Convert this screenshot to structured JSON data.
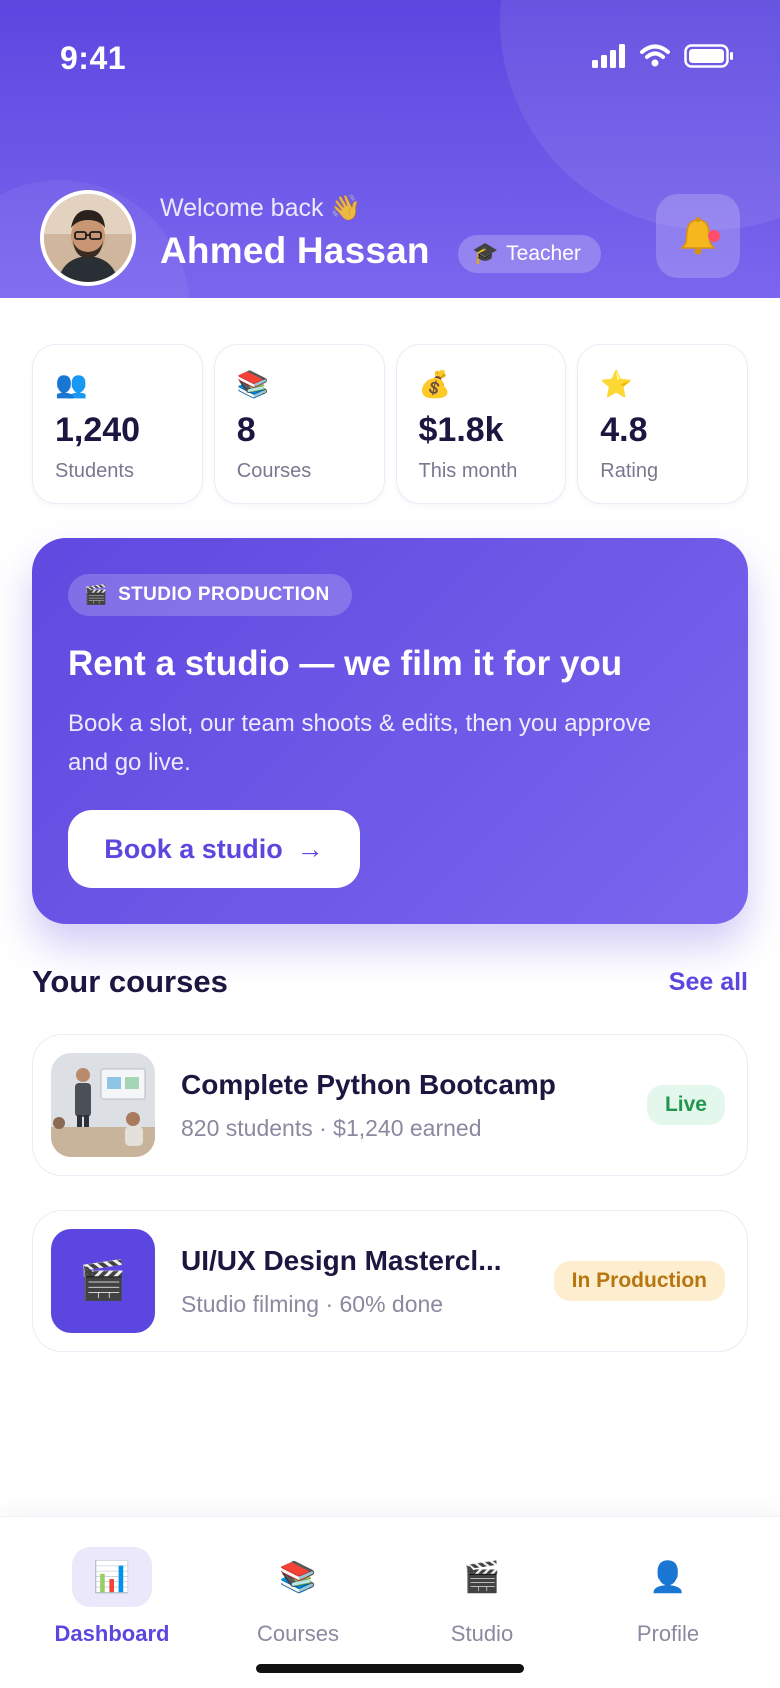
{
  "status_bar": {
    "time": "9:41"
  },
  "header": {
    "welcome": "Welcome back 👋",
    "name": "Ahmed Hassan",
    "role": "Teacher",
    "role_icon": "🎓"
  },
  "stats": [
    {
      "icon": "👥",
      "value": "1,240",
      "label": "Students"
    },
    {
      "icon": "📚",
      "value": "8",
      "label": "Courses"
    },
    {
      "icon": "💰",
      "value": "$1.8k",
      "label": "This month"
    },
    {
      "icon": "⭐",
      "value": "4.8",
      "label": "Rating"
    }
  ],
  "promo": {
    "tag_icon": "🎬",
    "tag": "STUDIO PRODUCTION",
    "title": "Rent a studio — we film it for you",
    "description": "Book a slot, our team shoots & edits, then you approve and go live.",
    "button": "Book a studio",
    "button_arrow": "→"
  },
  "courses_section": {
    "title": "Your courses",
    "see_all": "See all",
    "items": [
      {
        "title": "Complete Python Bootcamp",
        "subtitle": "820 students · $1,240 earned",
        "status": "Live"
      },
      {
        "title": "UI/UX Design Mastercl...",
        "subtitle": "Studio filming · 60% done",
        "status": "In Production",
        "thumb_icon": "🎬"
      }
    ]
  },
  "tabbar": {
    "items": [
      {
        "label": "Dashboard",
        "icon": "📊",
        "active": true
      },
      {
        "label": "Courses",
        "icon": "📚"
      },
      {
        "label": "Studio",
        "icon": "🎬"
      },
      {
        "label": "Profile",
        "icon": "👤"
      }
    ]
  },
  "colors": {
    "primary": "#5b47df",
    "live": "#22964f",
    "production": "#b87611"
  }
}
